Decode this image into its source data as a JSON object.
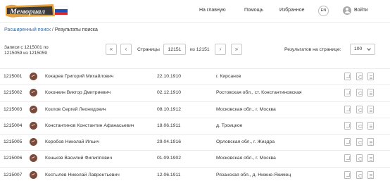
{
  "header": {
    "logo_text": "Мемориал",
    "nav": [
      "На главную",
      "Помощь",
      "Избранное"
    ],
    "lang": "EN",
    "login_label": "Войти",
    "icons": {
      "login": "user-icon",
      "logo": "memorial-logo-icon"
    }
  },
  "breadcrumb": {
    "parent": "Расширенный поиск",
    "separator": "/",
    "current": "Результаты поиска"
  },
  "pager": {
    "records_line1": "Записи с 1215001 по",
    "records_line2": "1215059 из 1215059",
    "first_label": "«",
    "prev_label": "‹",
    "pages_label": "Страницы",
    "page_value": "12151",
    "of_label": "из 12151",
    "next_label": "›",
    "last_label": "»",
    "per_page_label": "Результатов на странице:",
    "per_page_value": "100"
  },
  "results": [
    {
      "id": "1215001",
      "name": "Кокарев Григорий Михайлович",
      "date": "22.10.1910",
      "place": "г. Кирсанов"
    },
    {
      "id": "1215002",
      "name": "Коконкин Виктор Дмитриевич",
      "date": "02.12.1910",
      "place": "Ростовская обл., ст. Константиновская"
    },
    {
      "id": "1215003",
      "name": "Козлов Сергей Леонидович",
      "date": "08.10.1912",
      "place": "Московская обл., г. Москва"
    },
    {
      "id": "1215004",
      "name": "Константинов Константин Афанасьевич",
      "date": "18.06.1911",
      "place": "д. Троицкое"
    },
    {
      "id": "1215005",
      "name": "Коробов Николай Ильич",
      "date": "29.04.1916",
      "place": "Орловская обл., г. Жиздра"
    },
    {
      "id": "1215006",
      "name": "Коньков Василий Филиппович",
      "date": "01.09.1902",
      "place": "Московская обл., г. Москва"
    },
    {
      "id": "1215007",
      "name": "Костылев Николай Лаврентьевич",
      "date": "12.06.1911",
      "place": "Рязанская обл., д. Нижне-Якимец"
    }
  ],
  "colors": {
    "link": "#3a6ea5",
    "avatar": "#7a4a3a",
    "logo_ribbon": "#d98b1e",
    "flag_white": "#ffffff",
    "flag_blue": "#1f4fb8",
    "flag_red": "#d22a2a"
  }
}
